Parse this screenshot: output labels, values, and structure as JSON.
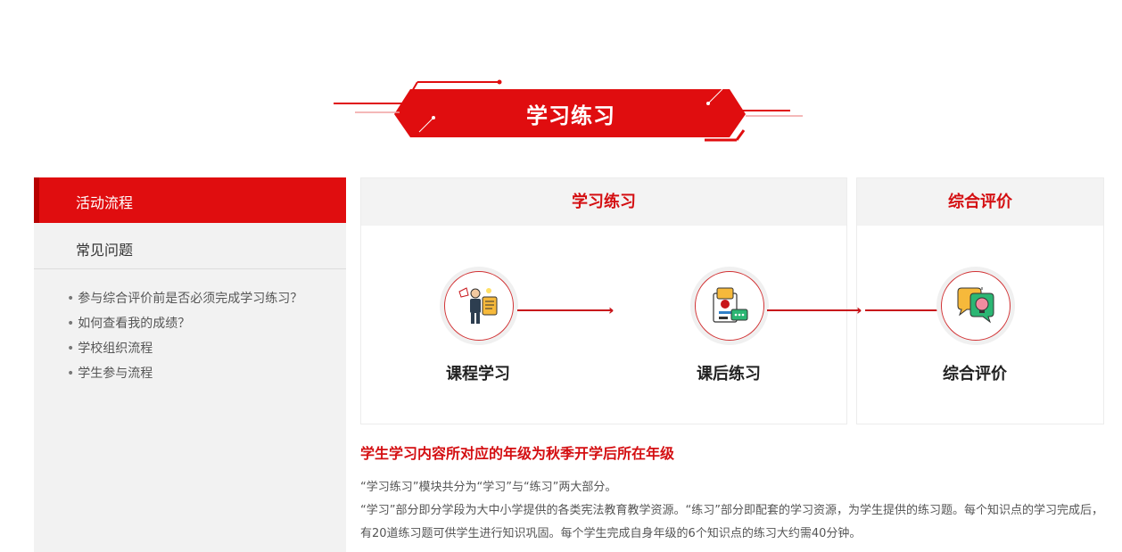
{
  "banner": {
    "title": "学习练习"
  },
  "sidebar": {
    "active_item": "活动流程",
    "faq_item": "常见问题",
    "faq_links": [
      "参与综合评价前是否必须完成学习练习？",
      "如何查看我的成绩？",
      "学校组织流程",
      "学生参与流程"
    ]
  },
  "panels": {
    "practice": {
      "title": "学习练习",
      "steps": [
        {
          "label": "课程学习",
          "icon": "teacher-presentation-icon"
        },
        {
          "label": "课后练习",
          "icon": "exercise-document-icon"
        }
      ]
    },
    "evaluation": {
      "title": "综合评价",
      "steps": [
        {
          "label": "综合评价",
          "icon": "idea-chat-icon"
        }
      ]
    }
  },
  "note": {
    "title": "学生学习内容所对应的年级为秋季开学后所在年级",
    "paragraphs": [
      "“学习练习”模块共分为“学习”与“练习”两大部分。",
      "“学习”部分即分学段为大中小学提供的各类宪法教育教学资源。“练习”部分即配套的学习资源，为学生提供的练习题。每个知识点的学习完成后，有20道练习题可供学生进行知识巩固。每个学生完成自身年级的6个知识点的练习大约需40分钟。"
    ]
  },
  "colors": {
    "brand_red": "#e00d0f",
    "dark_red": "#b80000",
    "panel_bg": "#f3f3f3"
  }
}
